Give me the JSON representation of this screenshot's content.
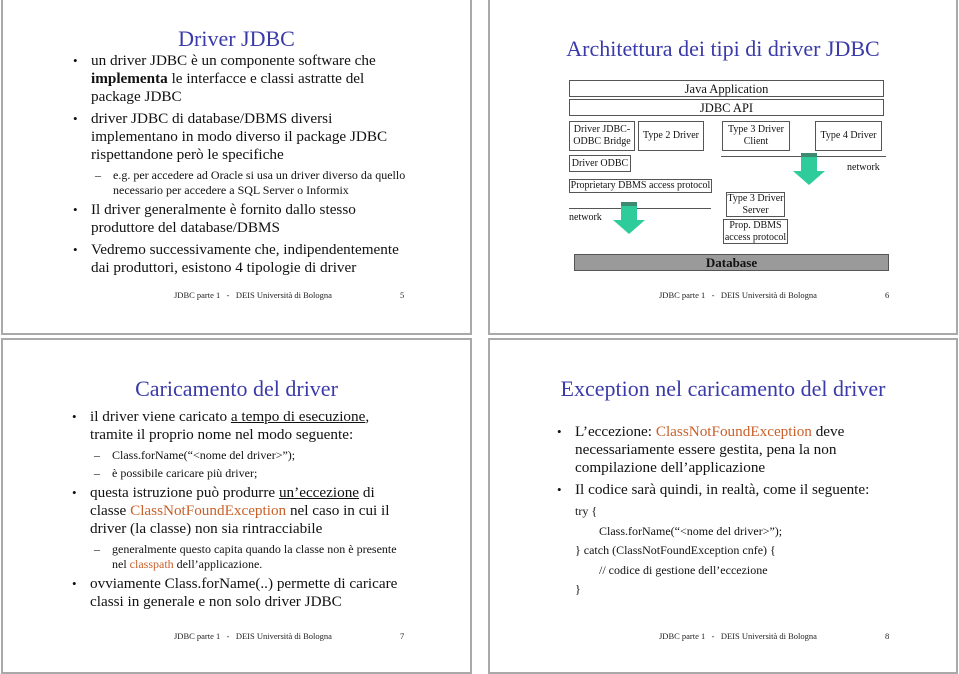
{
  "colors": {
    "title": "#3a3aa8",
    "highlight": "#c8602a",
    "arrow": "#2ecc9a",
    "arrow_cap": "#3c8a72",
    "database_fill": "#9a9a9a",
    "slide_border": "#a9a9a9"
  },
  "footer_text": "JDBC parte 1   -   DEIS Università di Bologna",
  "slides": [
    {
      "page": "5",
      "title": "Driver JDBC",
      "bullets": {
        "b1_pre": "un driver JDBC è un componente software che ",
        "b1_bold": "implementa",
        "b1_post": " le interfacce e classi astratte del package JDBC",
        "b2": "driver JDBC di database/DBMS diversi implementano in modo diverso il package JDBC rispettandone però le specifiche",
        "b2_sub": "e.g. per accedere ad Oracle si usa un driver diverso da quello necessario per accedere a SQL Server o Informix",
        "b3": "Il driver generalmente è fornito dallo stesso produttore del database/DBMS",
        "b4": "Vedremo successivamente che, indipendentemente dai produttori, esistono 4 tipologie di driver"
      }
    },
    {
      "page": "6",
      "title": "Architettura dei tipi di driver JDBC",
      "diagram": {
        "java_application": "Java Application",
        "jdbc_api": "JDBC API",
        "bridge": "Driver JDBC-ODBC Bridge",
        "type2": "Type 2 Driver",
        "type3_client": "Type 3 Driver Client",
        "type4": "Type 4 Driver",
        "driver_odbc": "Driver ODBC",
        "proprietary": "Proprietary DBMS access protocol",
        "network_left": "network",
        "network_right": "network",
        "type3_server": "Type 3 Driver Server",
        "prop_dbms": "Prop. DBMS access protocol",
        "database": "Database"
      }
    },
    {
      "page": "7",
      "title": "Caricamento del driver",
      "bullets": {
        "b1_pre": "il driver viene caricato ",
        "b1_u": "a tempo di esecuzione",
        "b1_post": ", tramite il proprio nome nel modo seguente:",
        "b1_sub1": "Class.forName(“<nome del driver>”);",
        "b1_sub2": "è possibile caricare più driver;",
        "b2_pre": "questa istruzione può produrre ",
        "b2_u": "un’eccezione",
        "b2_mid": " di classe ",
        "b2_hl": "ClassNotFoundException",
        "b2_post": " nel caso in cui il driver (la classe) non sia rintracciabile",
        "b2_sub_pre": "generalmente questo capita quando la classe non è presente nel ",
        "b2_sub_hl": "classpath",
        "b2_sub_post": " dell’applicazione.",
        "b3": "ovviamente Class.forName(..) permette di caricare classi in generale e non solo driver JDBC"
      }
    },
    {
      "page": "8",
      "title": "Exception nel caricamento del driver",
      "bullets": {
        "b1_pre": "L’eccezione: ",
        "b1_hl": "ClassNotFoundException",
        "b1_post": " deve necessariamente essere gestita, pena la non compilazione dell’applicazione",
        "b2": "Il codice sarà quindi, in realtà, come il seguente:",
        "code": [
          "try {",
          "Class.forName(“<nome del driver>”);",
          "} catch (ClassNotFoundException cnfe) {",
          "// codice di gestione dell’eccezione",
          "}"
        ]
      }
    }
  ]
}
